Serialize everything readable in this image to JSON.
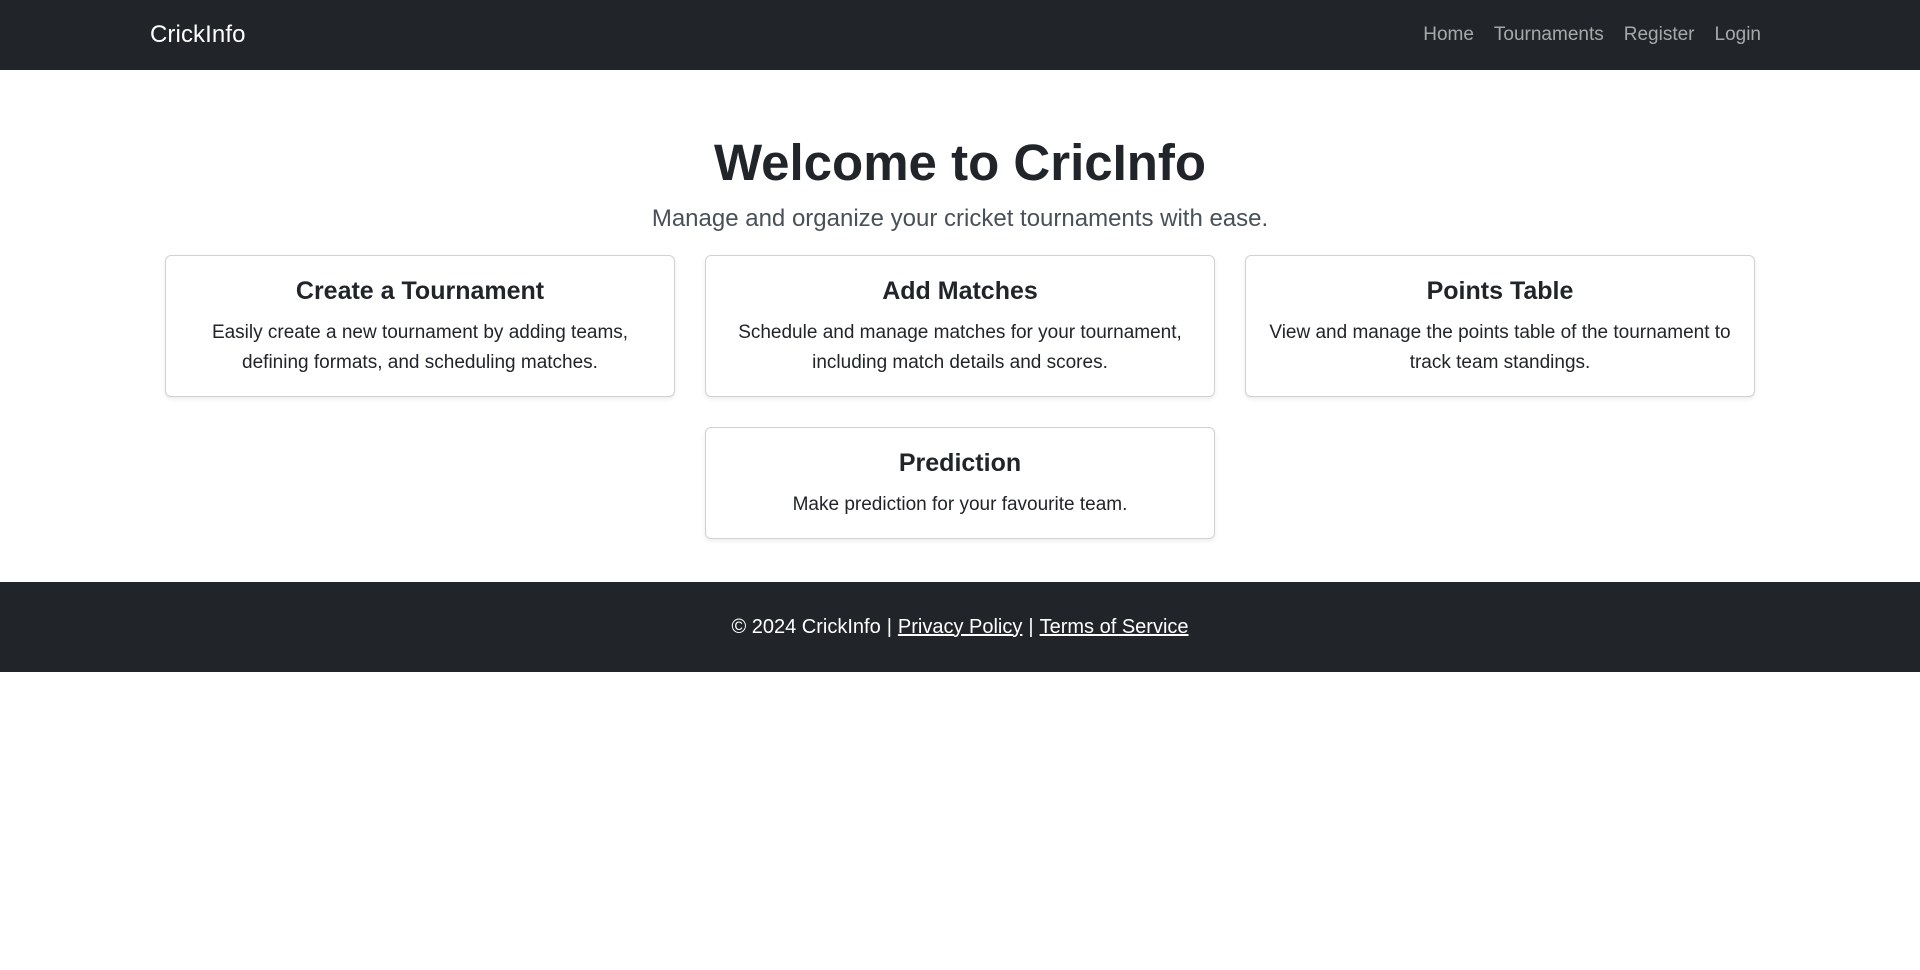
{
  "navbar": {
    "brand": "CrickInfo",
    "links": [
      "Home",
      "Tournaments",
      "Register",
      "Login"
    ]
  },
  "hero": {
    "title": "Welcome to CricInfo",
    "lead": "Manage and organize your cricket tournaments with ease."
  },
  "cards": [
    {
      "title": "Create a Tournament",
      "text": "Easily create a new tournament by adding teams, defining formats, and scheduling matches."
    },
    {
      "title": "Add Matches",
      "text": "Schedule and manage matches for your tournament, including match details and scores."
    },
    {
      "title": "Points Table",
      "text": "View and manage the points table of the tournament to track team standings."
    },
    {
      "title": "Prediction",
      "text": "Make prediction for your favourite team."
    }
  ],
  "footer": {
    "copyright": "© 2024 CrickInfo",
    "separator": "|",
    "privacy": "Privacy Policy",
    "terms": "Terms of Service"
  },
  "colors": {
    "navbar_bg": "#212529",
    "footer_bg": "#212529",
    "text": "#212529"
  }
}
